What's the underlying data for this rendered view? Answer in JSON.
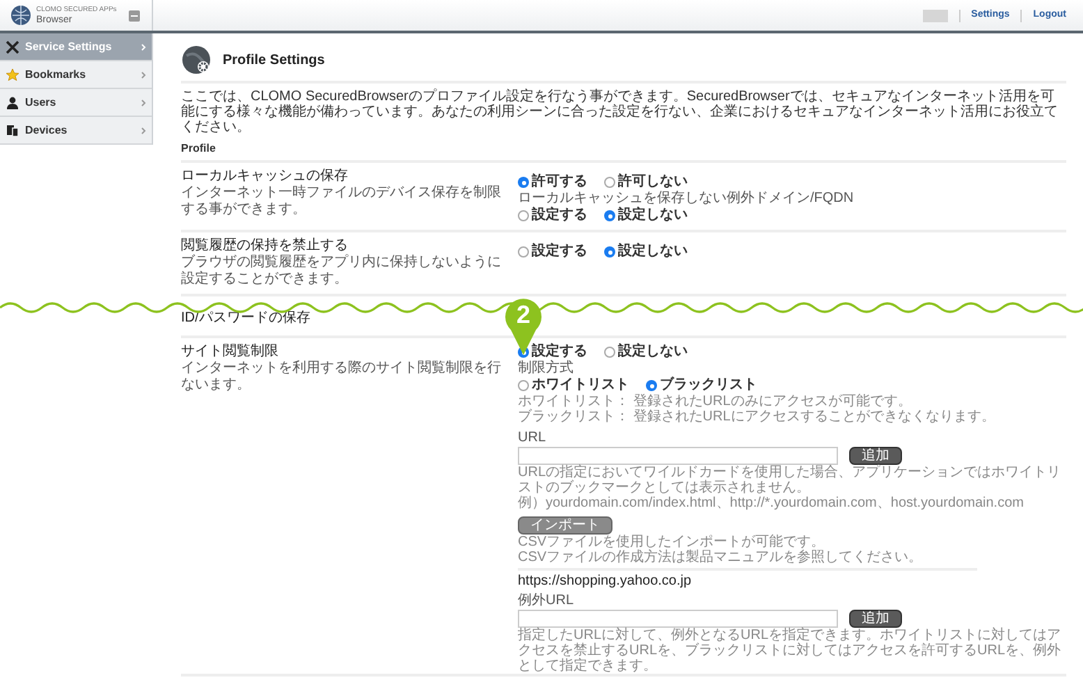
{
  "app": {
    "brand_line1": "CLOMO SECURED APPs",
    "brand_line2": "Browser"
  },
  "top_nav": {
    "links": [
      "Settings",
      "Logout"
    ]
  },
  "sidebar": {
    "items": [
      {
        "label": "Service Settings",
        "kind": "tools",
        "selected": true
      },
      {
        "label": "Bookmarks",
        "kind": "star",
        "selected": false
      },
      {
        "label": "Users",
        "kind": "user",
        "selected": false
      },
      {
        "label": "Devices",
        "kind": "devices",
        "selected": false
      }
    ]
  },
  "page": {
    "title": "Profile Settings",
    "intro": "ここでは、CLOMO SecuredBrowserのプロファイル設定を行なう事ができます。SecuredBrowserでは、セキュアなインターネット活用を可能にする様々な機能が備わっています。あなたの利用シーンに合った設定を行ない、企業におけるセキュアなインターネット活用にお役立てください。",
    "section": "Profile"
  },
  "settings": [
    {
      "kind": "radio",
      "title": "ローカルキャッシュの保存",
      "description": "インターネット一時ファイルのデバイス保存を制限する事ができます。",
      "options": [
        {
          "label": "許可する",
          "selected": true
        },
        {
          "label": "許可しない",
          "selected": false
        }
      ],
      "sub": {
        "label": "ローカルキャッシュを保存しない例外ドメイン/FQDN",
        "options": [
          {
            "label": "設定する",
            "selected": false
          },
          {
            "label": "設定しない",
            "selected": true
          }
        ]
      }
    },
    {
      "kind": "radio",
      "title": "閲覧履歴の保持を禁止する",
      "description": "ブラウザの閲覧履歴をアプリ内に保持しないように設定することができます。",
      "options": [
        {
          "label": "設定する",
          "selected": false
        },
        {
          "label": "設定しない",
          "selected": true
        }
      ]
    },
    {
      "kind": "collapsed",
      "title": "ID/パスワードの保存"
    },
    {
      "kind": "site_filter",
      "title": "サイト閲覧制限",
      "description": "インターネットを利用する際のサイト閲覧制限を行ないます。",
      "options": [
        {
          "label": "設定する",
          "selected": true
        },
        {
          "label": "設定しない",
          "selected": false
        }
      ],
      "method_label": "制限方式",
      "method_options": [
        {
          "label": "ホワイトリスト",
          "selected": false
        },
        {
          "label": "ブラックリスト",
          "selected": true
        }
      ],
      "method_notes": [
        "ホワイトリスト： 登録されたURLのみにアクセスが可能です。",
        "ブラックリスト： 登録されたURLにアクセスすることができなくなります。"
      ],
      "url_label": "URL",
      "add_button": "追加",
      "url_notes": [
        "URLの指定においてワイルドカードを使用した場合、アプリケーションではホワイトリストのブックマークとしては表示されません。",
        "例）yourdomain.com/index.html、http://*.yourdomain.com、host.yourdomain.com"
      ],
      "import_button": "インポート",
      "csv_notes": [
        "CSVファイルを使用したインポートが可能です。",
        "CSVファイルの作成方法は製品マニュアルを参照してください。"
      ],
      "listed_url": "https://shopping.yahoo.co.jp",
      "exception_label": "例外URL",
      "exception_button": "追加",
      "exception_note": "指定したURLに対して、例外となるURLを指定できます。ホワイトリストに対してはアクセスを禁止するURLを、ブラックリストに対してはアクセスを許可するURLを、例外として指定できます。"
    }
  ],
  "annotation": {
    "marker": "2"
  }
}
